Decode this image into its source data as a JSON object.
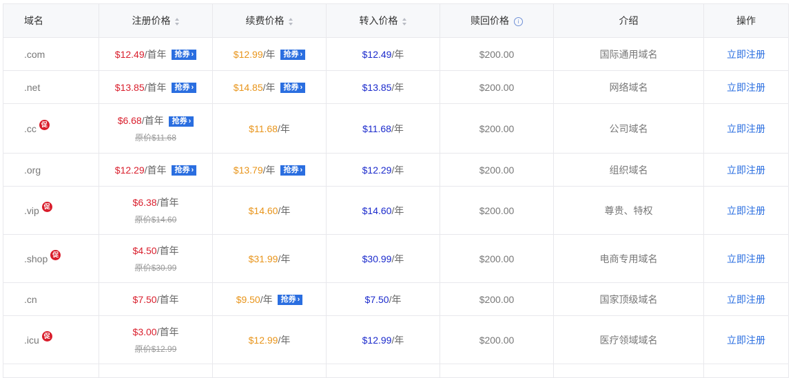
{
  "headers": {
    "domain": "域名",
    "register": "注册价格",
    "renew": "续费价格",
    "transfer": "转入价格",
    "redeem": "赎回价格",
    "intro": "介绍",
    "action": "操作"
  },
  "labels": {
    "coupon": "抢券",
    "promo": "促",
    "first_year": "/首年",
    "per_year": "/年",
    "register_now": "立即注册"
  },
  "rows": [
    {
      "name": ".com",
      "promo": false,
      "reg": "$12.49",
      "reg_orig": "",
      "reg_coupon": true,
      "renew": "$12.99",
      "renew_coupon": true,
      "transfer": "$12.49",
      "redeem": "$200.00",
      "intro": "国际通用域名"
    },
    {
      "name": ".net",
      "promo": false,
      "reg": "$13.85",
      "reg_orig": "",
      "reg_coupon": true,
      "renew": "$14.85",
      "renew_coupon": true,
      "transfer": "$13.85",
      "redeem": "$200.00",
      "intro": "网络域名"
    },
    {
      "name": ".cc",
      "promo": true,
      "reg": "$6.68",
      "reg_orig": "原价$11.68",
      "reg_coupon": true,
      "renew": "$11.68",
      "renew_coupon": false,
      "transfer": "$11.68",
      "redeem": "$200.00",
      "intro": "公司域名"
    },
    {
      "name": ".org",
      "promo": false,
      "reg": "$12.29",
      "reg_orig": "",
      "reg_coupon": true,
      "renew": "$13.79",
      "renew_coupon": true,
      "transfer": "$12.29",
      "redeem": "$200.00",
      "intro": "组织域名"
    },
    {
      "name": ".vip",
      "promo": true,
      "reg": "$6.38",
      "reg_orig": "原价$14.60",
      "reg_coupon": false,
      "renew": "$14.60",
      "renew_coupon": false,
      "transfer": "$14.60",
      "redeem": "$200.00",
      "intro": "尊贵、特权"
    },
    {
      "name": ".shop",
      "promo": true,
      "reg": "$4.50",
      "reg_orig": "原价$30.99",
      "reg_coupon": false,
      "renew": "$31.99",
      "renew_coupon": false,
      "transfer": "$30.99",
      "redeem": "$200.00",
      "intro": "电商专用域名"
    },
    {
      "name": ".cn",
      "promo": false,
      "reg": "$7.50",
      "reg_orig": "",
      "reg_coupon": false,
      "renew": "$9.50",
      "renew_coupon": true,
      "transfer": "$7.50",
      "redeem": "$200.00",
      "intro": "国家顶级域名"
    },
    {
      "name": ".icu",
      "promo": true,
      "reg": "$3.00",
      "reg_orig": "原价$12.99",
      "reg_coupon": false,
      "renew": "$12.99",
      "renew_coupon": false,
      "transfer": "$12.99",
      "redeem": "$200.00",
      "intro": "医疗领域域名"
    }
  ]
}
